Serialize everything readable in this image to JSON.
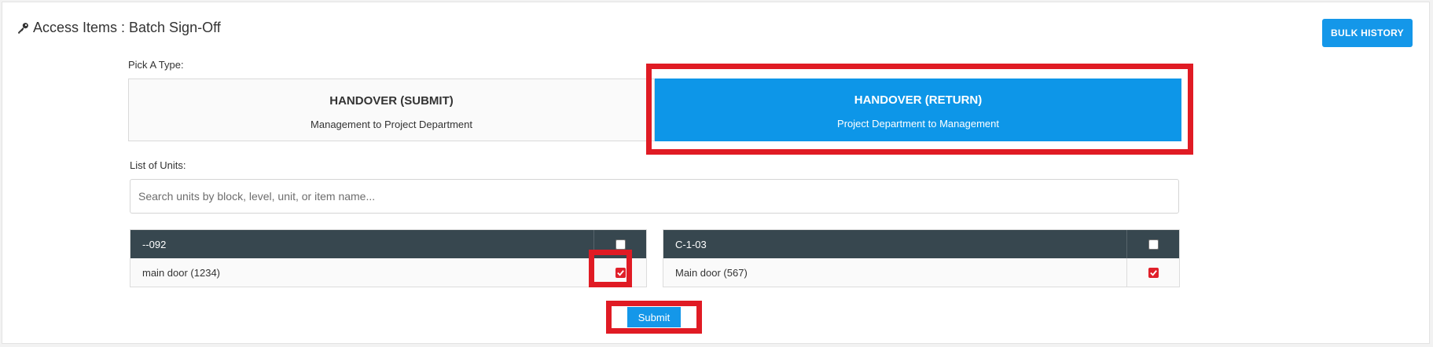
{
  "header": {
    "title": "Access Items : Batch Sign-Off",
    "bulk_history_label": "BULK HISTORY"
  },
  "type_picker": {
    "label": "Pick A Type:",
    "options": [
      {
        "title": "HANDOVER (SUBMIT)",
        "subtitle": "Management to Project Department",
        "selected": false
      },
      {
        "title": "HANDOVER (RETURN)",
        "subtitle": "Project Department to Management",
        "selected": true
      }
    ]
  },
  "units": {
    "label": "List of Units:",
    "search_placeholder": "Search units by block, level, unit, or item name...",
    "tables": [
      {
        "unit": "--092",
        "header_checked": false,
        "items": [
          {
            "name": "main door (1234)",
            "checked": true
          }
        ]
      },
      {
        "unit": "C-1-03",
        "header_checked": false,
        "items": [
          {
            "name": "Main door (567)",
            "checked": true
          }
        ]
      }
    ]
  },
  "submit_label": "Submit",
  "colors": {
    "accent": "#1497e9",
    "highlight": "#e01b24",
    "table_header": "#37474f"
  }
}
